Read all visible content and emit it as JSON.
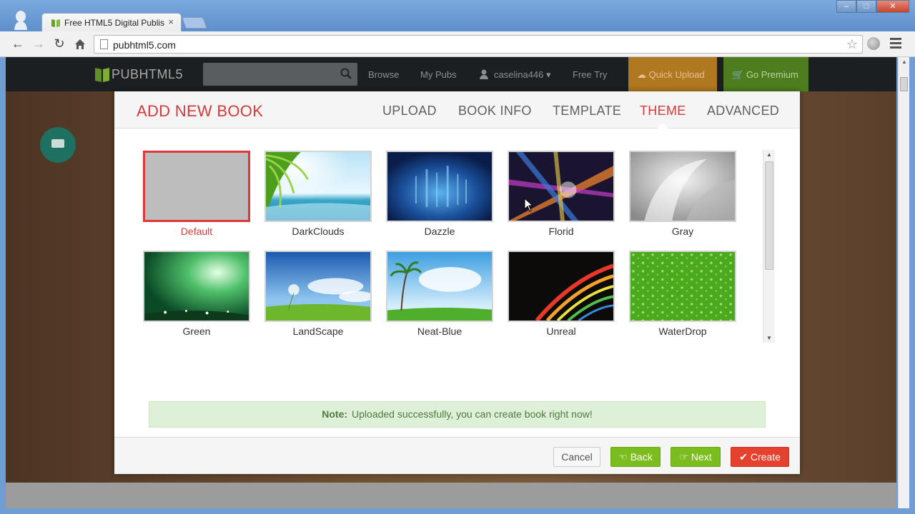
{
  "browser": {
    "tab_title": "Free HTML5 Digital Publis",
    "tab_close": "×",
    "url": "pubhtml5.com",
    "win_minimize": "–",
    "win_maximize": "□",
    "win_close": "✕"
  },
  "site_nav": {
    "logo": "PUBHTML5",
    "browse": "Browse",
    "my_pubs": "My Pubs",
    "username": "caselina446",
    "free_try": "Free Try",
    "quick_upload": "Quick Upload",
    "go_premium": "Go Premium"
  },
  "modal": {
    "title": "ADD NEW BOOK",
    "steps": [
      {
        "label": "UPLOAD",
        "active": false
      },
      {
        "label": "BOOK INFO",
        "active": false
      },
      {
        "label": "TEMPLATE",
        "active": false
      },
      {
        "label": "THEME",
        "active": true
      },
      {
        "label": "ADVANCED",
        "active": false
      }
    ],
    "themes": [
      {
        "name": "Default",
        "selected": true
      },
      {
        "name": "DarkClouds",
        "selected": false
      },
      {
        "name": "Dazzle",
        "selected": false
      },
      {
        "name": "Florid",
        "selected": false
      },
      {
        "name": "Gray",
        "selected": false
      },
      {
        "name": "Green",
        "selected": false
      },
      {
        "name": "LandScape",
        "selected": false
      },
      {
        "name": "Neat-Blue",
        "selected": false
      },
      {
        "name": "Unreal",
        "selected": false
      },
      {
        "name": "WaterDrop",
        "selected": false
      }
    ],
    "note_label": "Note:",
    "note_text": "Uploaded successfully, you can create book right now!",
    "buttons": {
      "cancel": "Cancel",
      "back": "Back",
      "next": "Next",
      "create": "Create"
    }
  },
  "colors": {
    "accent_red": "#d33b3b",
    "button_green": "#7bbd1f",
    "button_red": "#e6412f",
    "note_bg": "#dff0d8"
  },
  "icons": {
    "back": "hand-left-icon",
    "next": "hand-right-icon",
    "create": "check-icon",
    "quick_upload": "cloud-upload-icon",
    "go_premium": "cart-icon"
  }
}
